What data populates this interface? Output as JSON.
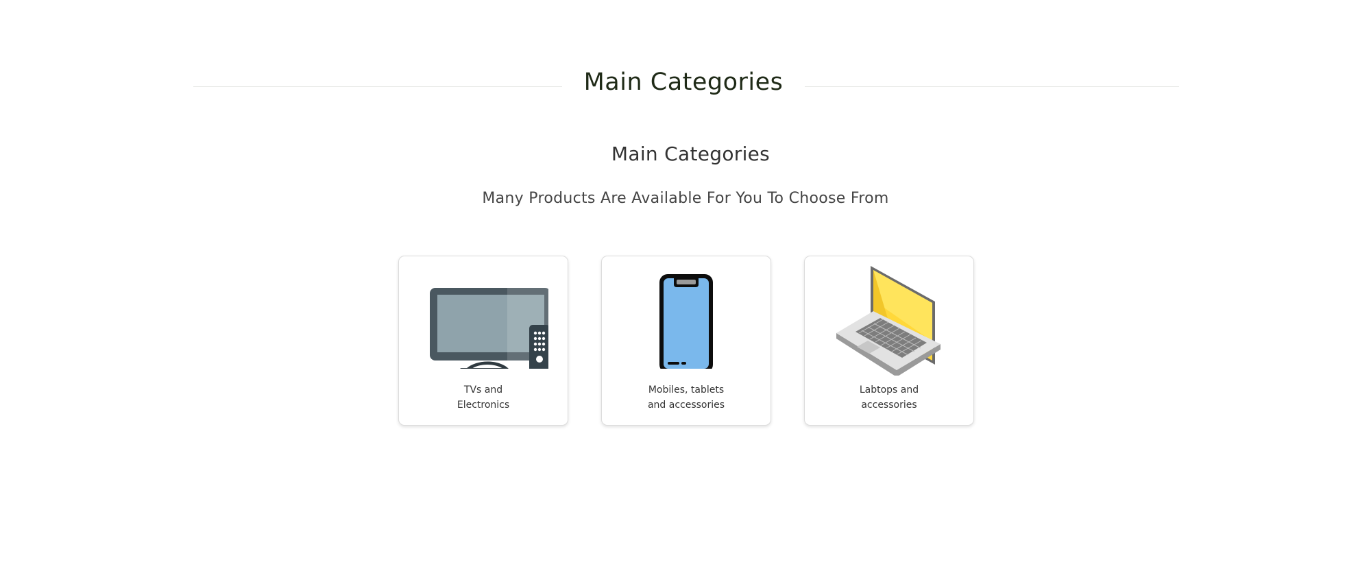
{
  "header": {
    "divider_title": "Main Categories"
  },
  "section": {
    "title": "Main Categories",
    "subtitle": "Many Products Are Available For You To Choose From"
  },
  "categories": [
    {
      "label": "TVs and\nElectronics",
      "icon": "tv-remote-icon"
    },
    {
      "label": "Mobiles, tablets\nand accessories",
      "icon": "smartphone-icon"
    },
    {
      "label": "Labtops and\naccessories",
      "icon": "laptop-icon"
    }
  ],
  "colors": {
    "heading": "#1f2a17",
    "tv_frame": "#4a5860",
    "tv_screen": "#8fa3ab",
    "phone_screen": "#7ab8ec",
    "laptop_screen": "#ffd83a"
  }
}
